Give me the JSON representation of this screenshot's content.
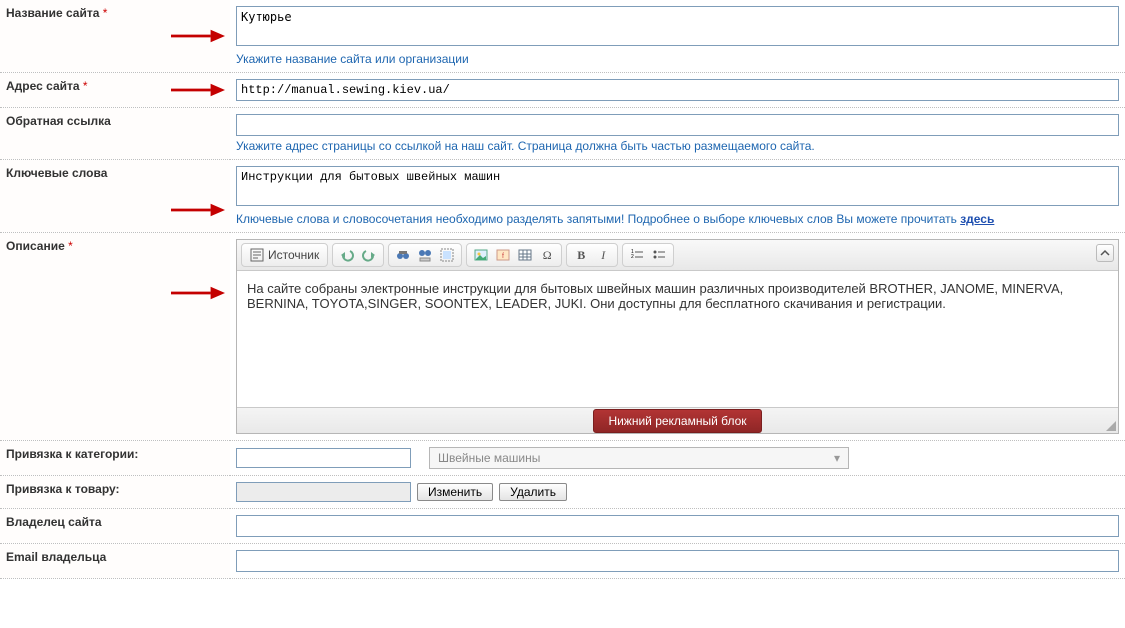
{
  "labels": {
    "site_name": "Название сайта",
    "site_url": "Адрес сайта",
    "backlink": "Обратная ссылка",
    "keywords": "Ключевые слова",
    "description": "Описание",
    "category": "Привязка к категории:",
    "product": "Привязка к товару:",
    "owner": "Владелец сайта",
    "owner_email": "Email владельца"
  },
  "required_mark": "*",
  "fields": {
    "site_name": "Кутюрье",
    "site_url": "http://manual.sewing.kiev.ua/",
    "backlink": "",
    "keywords": "Инструкции для бытовых швейных машин",
    "description_html": "На сайте собраны электронные инструкции для бытовых швейных машин различных производителей BROTHER, JANOME, MINERVA, BERNINA, TOYOTA,SINGER, SOONTEX, LEADER, JUKI. Они доступны для бесплатного скачивания и регистрации.",
    "product": "",
    "owner": "",
    "owner_email": ""
  },
  "hints": {
    "site_name": "Укажите название сайта или организации",
    "backlink": "Укажите адрес страницы со ссылкой на наш сайт. Страница должна быть частью размещаемого сайта.",
    "keywords_pre": "Ключевые слова и словосочетания необходимо разделять запятыми! Подробнее о выборе ключевых слов Вы можете прочитать ",
    "keywords_link": "здесь"
  },
  "editor": {
    "source_label": "Источник",
    "ad_button": "Нижний рекламный блок"
  },
  "category": {
    "selected": "Швейные машины"
  },
  "buttons": {
    "change": "Изменить",
    "delete": "Удалить"
  }
}
